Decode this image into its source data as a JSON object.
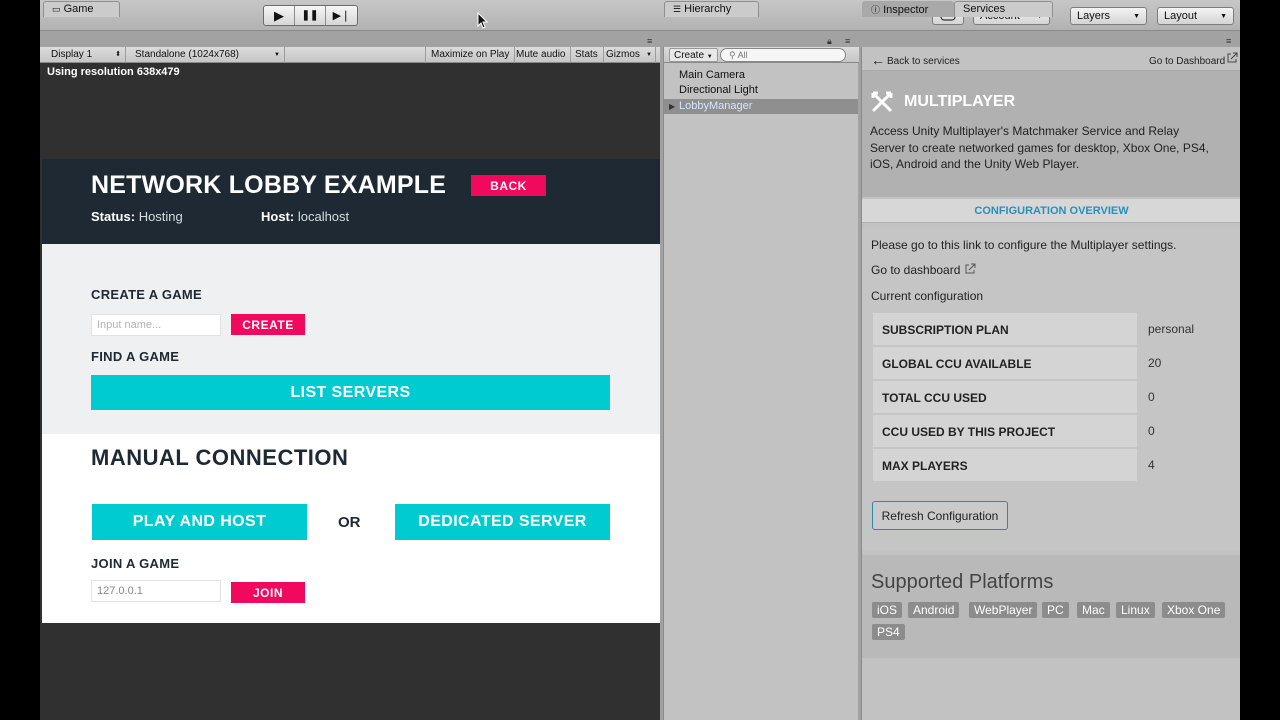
{
  "toolbar": {
    "play_icon": "▶",
    "pause_icon": "❚❚",
    "step_icon": "▶❘",
    "account_label": "Account",
    "layers_label": "Layers",
    "layout_label": "Layout"
  },
  "game": {
    "tab_label": "Game",
    "display": "Display 1",
    "resolution_select": "Standalone (1024x768)",
    "maximize": "Maximize on Play",
    "mute": "Mute audio",
    "stats": "Stats",
    "gizmos": "Gizmos",
    "resolution_text": "Using resolution 638x479",
    "lobby": {
      "title": "NETWORK LOBBY EXAMPLE",
      "back": "BACK",
      "status_label": "Status:",
      "status_value": "Hosting",
      "host_label": "Host:",
      "host_value": "localhost",
      "create_label": "CREATE A GAME",
      "name_placeholder": "Input name...",
      "create_button": "CREATE",
      "find_label": "FIND A GAME",
      "list_servers": "LIST SERVERS",
      "manual_title": "MANUAL CONNECTION",
      "play_and_host": "PLAY AND HOST",
      "or_label": "OR",
      "dedicated_server": "DEDICATED SERVER",
      "join_label": "JOIN A GAME",
      "ip_value": "127.0.0.1",
      "join_button": "JOIN"
    }
  },
  "hierarchy": {
    "tab_label": "Hierarchy",
    "create_label": "Create",
    "search_placeholder": "All",
    "items": [
      "Main Camera",
      "Directional Light",
      "LobbyManager"
    ]
  },
  "services": {
    "inspector_tab": "Inspector",
    "services_tab": "Services",
    "back_link": "Back to services",
    "dashboard_link": "Go to Dashboard",
    "title": "MULTIPLAYER",
    "description": "Access Unity Multiplayer's Matchmaker Service and Relay Server to create networked games for desktop, Xbox One, PS4, iOS, Android and the Unity Web Player.",
    "config_overview": "CONFIGURATION OVERVIEW",
    "link_text": "Please go to this link to configure the Multiplayer settings.",
    "go_to_dashboard": "Go to dashboard",
    "current_config": "Current configuration",
    "config_rows": [
      {
        "key": "SUBSCRIPTION PLAN",
        "value": "personal"
      },
      {
        "key": "GLOBAL CCU AVAILABLE",
        "value": "20"
      },
      {
        "key": "TOTAL CCU USED",
        "value": "0"
      },
      {
        "key": "CCU USED BY THIS PROJECT",
        "value": "0"
      },
      {
        "key": "MAX PLAYERS",
        "value": "4"
      }
    ],
    "refresh_button": "Refresh Configuration",
    "platforms_title": "Supported Platforms",
    "platforms": [
      "iOS",
      "Android",
      "WebPlayer",
      "PC",
      "Mac",
      "Linux",
      "Xbox One",
      "PS4"
    ]
  },
  "colors": {
    "accent_pink": "#f1095d",
    "accent_cyan": "#00cbd1",
    "header_dark": "#1f2933",
    "link_blue": "#2b8fb8"
  }
}
